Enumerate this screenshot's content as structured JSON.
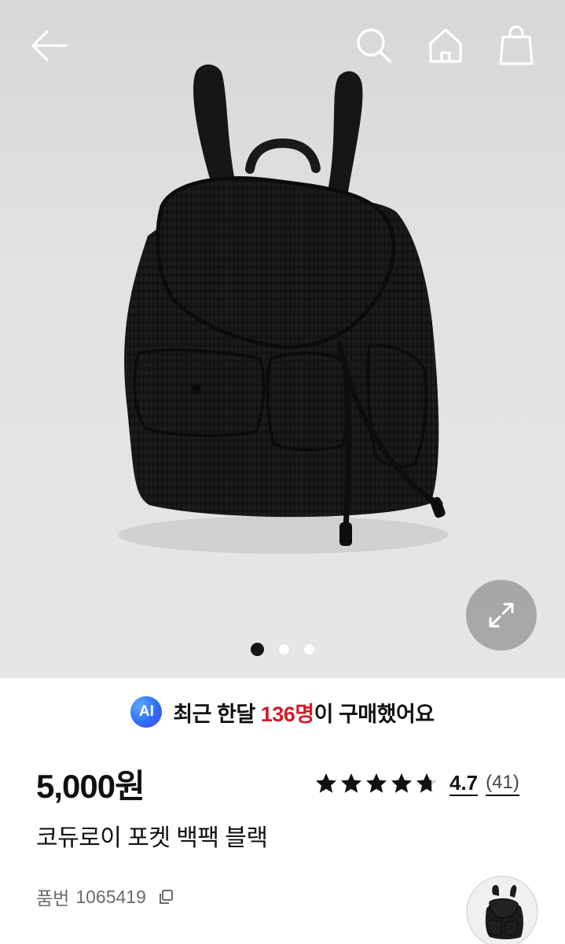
{
  "header": {
    "back_icon": "arrow-left-icon",
    "search_icon": "search-icon",
    "home_icon": "home-icon",
    "cart_icon": "shopping-bag-icon"
  },
  "gallery": {
    "image_subject": "black corduroy pocket backpack",
    "dot_count": 3,
    "active_index": 0,
    "expand_icon": "expand-icon"
  },
  "ai_banner": {
    "badge": "AI",
    "prefix": "최근 한달 ",
    "highlight": "136명",
    "suffix": "이 구매했어요",
    "highlight_color": "#d31b2a"
  },
  "product": {
    "price": "5,000원",
    "rating": "4.7",
    "rating_value": 4.7,
    "review_count": "(41)",
    "name": "코듀로이 포켓 백팩 블랙",
    "sku_label": "품번",
    "sku": "1065419"
  }
}
